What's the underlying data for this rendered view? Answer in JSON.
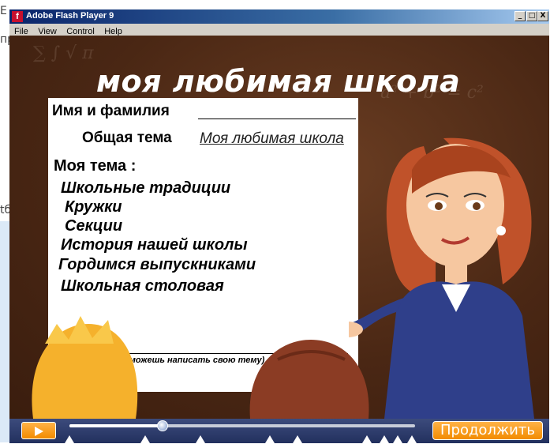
{
  "background_doc": {
    "fragments": [
      "E",
      "пр",
      "tб"
    ]
  },
  "window": {
    "title": "Adobe Flash Player 9",
    "app_icon_glyph": "f",
    "controls": {
      "minimize": "_",
      "maximize": "□",
      "close": "X"
    }
  },
  "menu": {
    "items": [
      "File",
      "View",
      "Control",
      "Help"
    ]
  },
  "slide": {
    "heading": "моя любимая школа",
    "name_label": "Имя и фамилия",
    "topic_label": "Общая тема",
    "topic_value": "Моя любимая школа",
    "my_topic_label": "Моя тема :",
    "topics": [
      "Школьные традиции",
      "Кружки",
      "Секции",
      "История нашей школы",
      "Гордимся выпускниками",
      "Школьная столовая"
    ],
    "note": "( можешь написать свою тему)"
  },
  "player": {
    "progress": 0.27,
    "markers": [
      0.0,
      0.22,
      0.38,
      0.58,
      0.66,
      0.86,
      0.91,
      0.95,
      0.99
    ],
    "next_label": "Продолжить",
    "colors": {
      "accent": "#f28b00",
      "bar": "#22305e"
    }
  },
  "icons": [
    "flash-icon",
    "play-icon",
    "minimize-icon",
    "maximize-icon",
    "close-icon"
  ]
}
